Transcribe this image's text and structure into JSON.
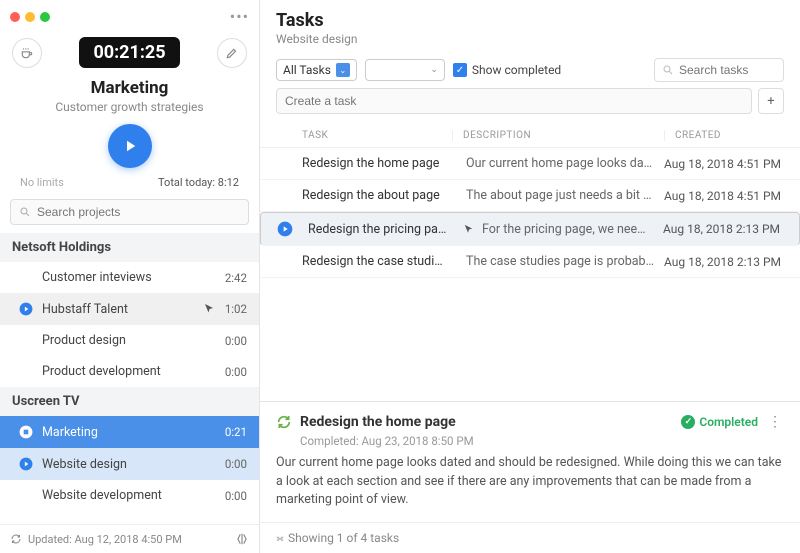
{
  "sidebar": {
    "timer": "00:21:25",
    "current_project": "Marketing",
    "current_desc": "Customer growth strategies",
    "no_limits": "No limits",
    "total_today_label": "Total today:",
    "total_today_value": "8:12",
    "search_placeholder": "Search projects",
    "groups": [
      {
        "name": "Netsoft Holdings",
        "projects": [
          {
            "name": "Customer inteviews",
            "time": "2:42",
            "play": false,
            "hover": false
          },
          {
            "name": "Hubstaff Talent",
            "time": "1:02",
            "play": true,
            "hover": true,
            "play_color": "#2f80ed"
          },
          {
            "name": "Product design",
            "time": "0:00",
            "play": false
          },
          {
            "name": "Product development",
            "time": "0:00",
            "play": false
          }
        ]
      },
      {
        "name": "Uscreen TV",
        "projects": [
          {
            "name": "Marketing",
            "time": "0:21",
            "play": true,
            "active": true,
            "stop": true
          },
          {
            "name": "Website design",
            "time": "0:00",
            "play": true,
            "sub": true,
            "play_color": "#2f80ed"
          },
          {
            "name": "Website development",
            "time": "0:00",
            "play": false
          }
        ]
      }
    ],
    "updated_label": "Updated:",
    "updated_value": "Aug 12, 2018 4:50 PM"
  },
  "main": {
    "title": "Tasks",
    "subtitle": "Website design",
    "filter_all": "All Tasks",
    "show_completed": "Show completed",
    "search_tasks_placeholder": "Search tasks",
    "create_placeholder": "Create a task",
    "columns": {
      "task": "TASK",
      "desc": "DESCRIPTION",
      "created": "CREATED"
    },
    "rows": [
      {
        "task": "Redesign the home page",
        "desc": "Our current home page looks dated and should…",
        "created": "Aug 18, 2018 4:51 PM"
      },
      {
        "task": "Redesign the about page",
        "desc": "The about page just needs a bit of makeup, bec…",
        "created": "Aug 18, 2018 4:51 PM"
      },
      {
        "task": "Redesign the pricing page",
        "desc": "For the pricing page, we need to try out a differe…",
        "created": "Aug 18, 2018 2:13 PM",
        "selected": true,
        "play": true
      },
      {
        "task": "Redesign the case studies pa…",
        "desc": "The case studies page is probably the one that …",
        "created": "Aug 18, 2018 2:13 PM"
      }
    ],
    "detail": {
      "title": "Redesign the home page",
      "status": "Completed",
      "completed_label": "Completed:",
      "completed_value": "Aug 23, 2018 8:50 PM",
      "body": "Our current home page looks dated and should be redesigned. While doing this we can take a look at each section and see if there are any improvements that can be made from a marketing point of view."
    },
    "footer": "Showing 1 of 4 tasks"
  }
}
